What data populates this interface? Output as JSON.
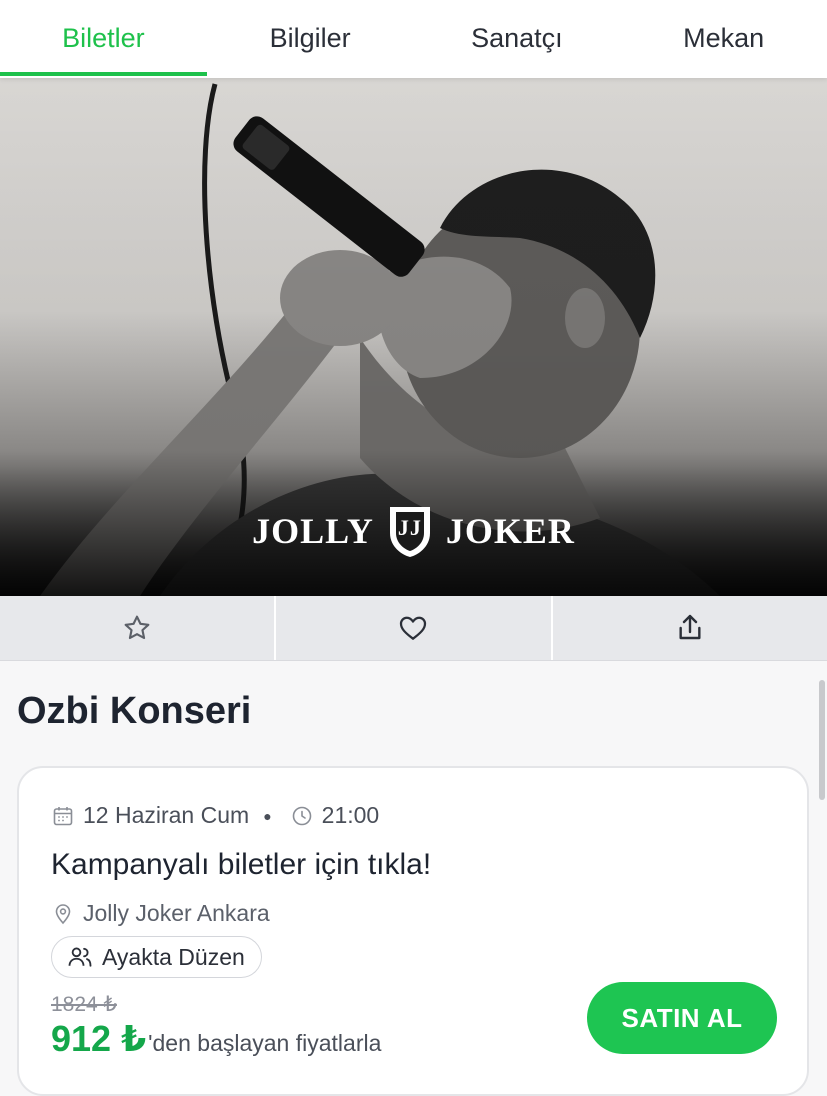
{
  "tabs": [
    {
      "label": "Biletler",
      "active": true
    },
    {
      "label": "Bilgiler",
      "active": false
    },
    {
      "label": "Sanatçı",
      "active": false
    },
    {
      "label": "Mekan",
      "active": false
    }
  ],
  "hero": {
    "brand_left": "JOLLY",
    "brand_right": "JOKER",
    "crest_letters": "JJ"
  },
  "actions": {
    "favorite_icon": "star-icon",
    "like_icon": "heart-icon",
    "share_icon": "share-icon"
  },
  "event": {
    "title": "Ozbi Konseri",
    "date": "12 Haziran Cum",
    "time": "21:00",
    "promo": "Kampanyalı biletler için tıkla!",
    "venue": "Jolly Joker Ankara",
    "layout": "Ayakta Düzen",
    "old_price": "1824 ₺",
    "price": "912 ₺",
    "price_suffix": "'den başlayan fiyatlarla",
    "buy_label": "SATIN AL"
  },
  "colors": {
    "accent": "#1ec14b",
    "price": "#14a74a",
    "button": "#1ec552"
  }
}
